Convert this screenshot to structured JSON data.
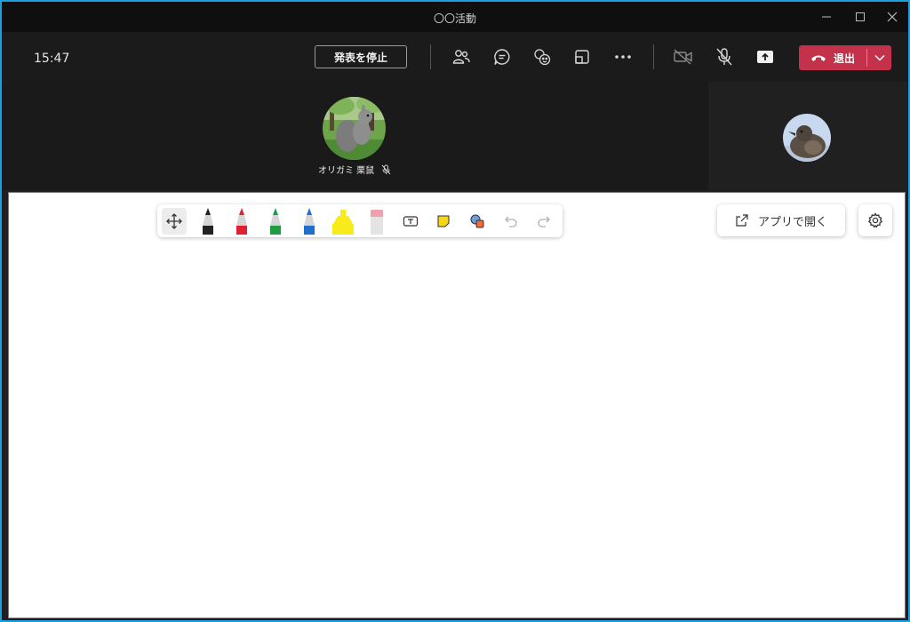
{
  "window": {
    "title": "〇〇活動"
  },
  "meeting": {
    "clock": "15:47",
    "stop_presenting_label": "発表を停止",
    "leave_label": "退出",
    "leave_color": "#c4314b"
  },
  "participants": {
    "main": {
      "name": "オリガミ 栗鼠",
      "muted": true
    }
  },
  "whiteboard": {
    "open_in_app_label": "アプリで開く",
    "pen_colors": [
      "#222222",
      "#e02030",
      "#1f9d45",
      "#1f6fd0"
    ],
    "highlighter_color": "#f7ec1a"
  },
  "icons": {
    "meeting_toolbar": [
      "people-icon",
      "chat-icon",
      "reactions-icon",
      "rooms-icon",
      "more-icon",
      "camera-off-icon",
      "mic-off-icon",
      "share-icon"
    ],
    "ink_toolbar": [
      "move-icon",
      "pen-black-icon",
      "pen-red-icon",
      "pen-green-icon",
      "pen-blue-icon",
      "highlighter-icon",
      "eraser-icon",
      "text-box-icon",
      "sticky-note-icon",
      "shapes-icon",
      "undo-icon",
      "redo-icon"
    ]
  }
}
